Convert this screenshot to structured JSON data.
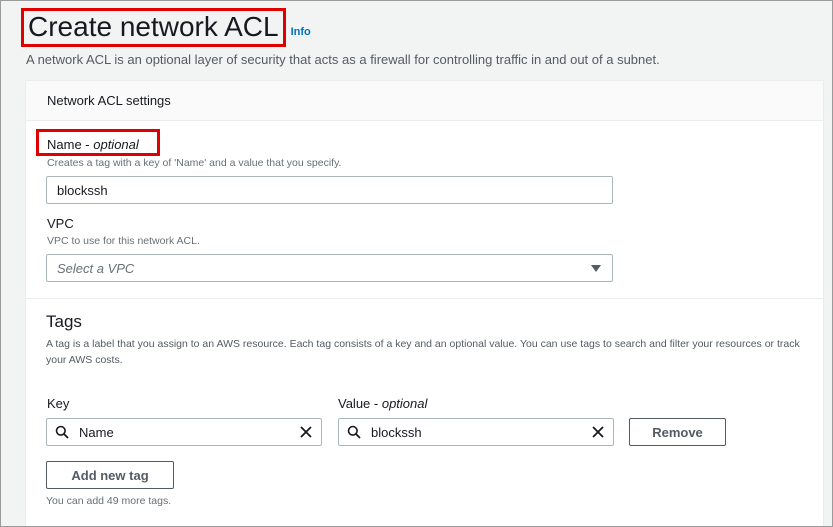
{
  "page": {
    "title": "Create network ACL",
    "info_link": "Info",
    "description": "A network ACL is an optional layer of security that acts as a firewall for controlling traffic in and out of a subnet."
  },
  "settings": {
    "header": "Network ACL settings",
    "name": {
      "label": "Name - ",
      "label_optional": "optional",
      "description": "Creates a tag with a key of 'Name' and a value that you specify.",
      "value": "blockssh"
    },
    "vpc": {
      "label": "VPC",
      "description": "VPC to use for this network ACL.",
      "placeholder": "Select a VPC"
    }
  },
  "tags": {
    "title": "Tags",
    "description": "A tag is a label that you assign to an AWS resource. Each tag consists of a key and an optional value. You can use tags to search and filter your resources or track your AWS costs.",
    "key_label": "Key",
    "value_label": "Value - ",
    "value_label_optional": "optional",
    "rows": [
      {
        "key": "Name",
        "value": "blockssh"
      }
    ],
    "remove_button": "Remove",
    "add_button": "Add new tag",
    "remaining_note": "You can add 49 more tags."
  },
  "icons": {
    "search": "search-icon",
    "clear": "close-icon",
    "dropdown": "caret-down-icon"
  },
  "colors": {
    "highlight": "#e00000",
    "link": "#0073bb"
  }
}
